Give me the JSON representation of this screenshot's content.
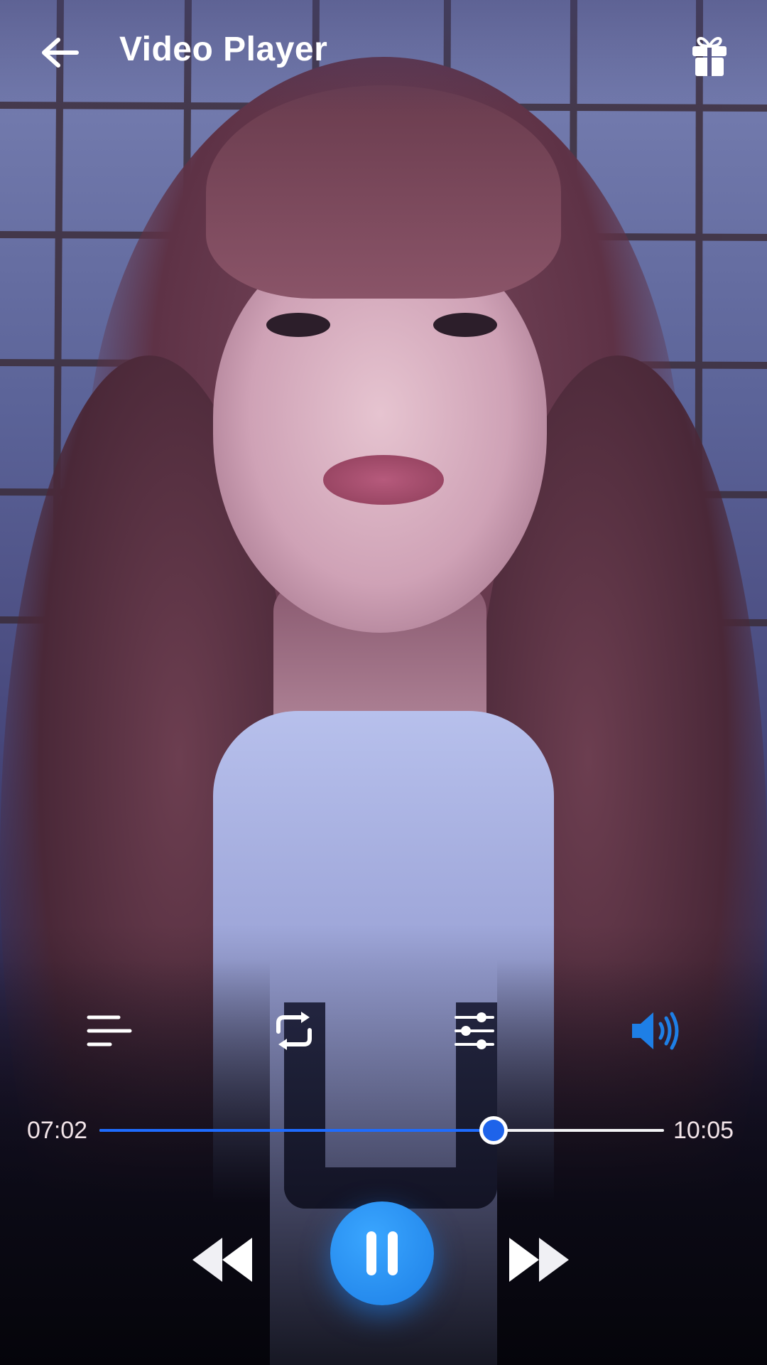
{
  "header": {
    "title": "Video Player",
    "back_icon": "arrow-left-icon",
    "gift_icon": "gift-icon"
  },
  "toolbar": {
    "items": [
      {
        "icon": "playlist-icon"
      },
      {
        "icon": "repeat-icon"
      },
      {
        "icon": "equalizer-icon"
      },
      {
        "icon": "volume-icon",
        "active": true
      }
    ]
  },
  "playback": {
    "current_time": "07:02",
    "total_time": "10:05",
    "progress": 0.698,
    "state": "playing"
  },
  "transport": {
    "rewind_icon": "rewind-icon",
    "pause_icon": "pause-icon",
    "forward_icon": "fast-forward-icon"
  },
  "colors": {
    "accent": "#1E6CFF",
    "play_button": "#2A92F2",
    "text": "#FFFFFF",
    "active_icon": "#1E7FE6"
  }
}
